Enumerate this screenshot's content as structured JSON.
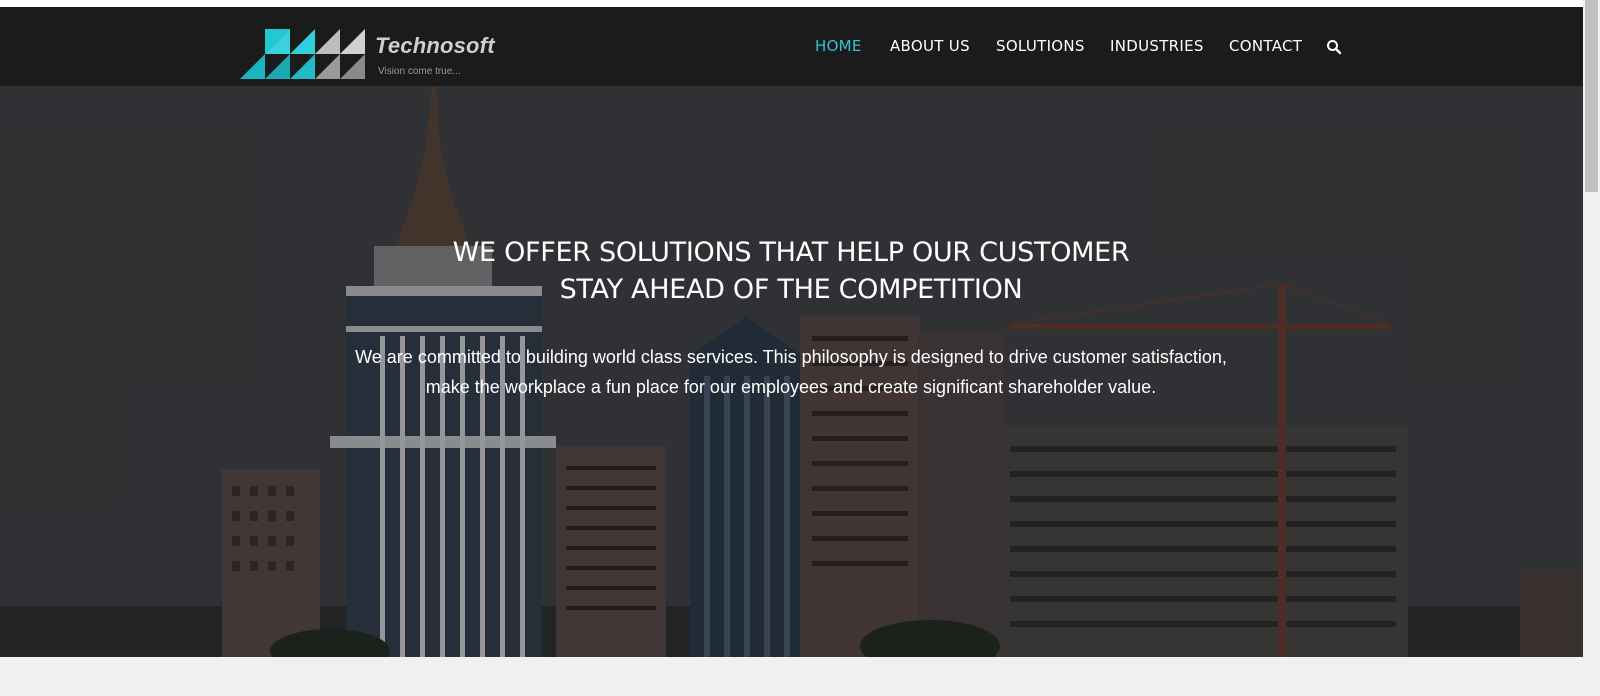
{
  "brand": {
    "name": "Technosoft",
    "tagline": "Vision come true..."
  },
  "nav": {
    "items": [
      {
        "label": "HOME",
        "active": true
      },
      {
        "label": "ABOUT US",
        "active": false
      },
      {
        "label": "SOLUTIONS",
        "active": false
      },
      {
        "label": "INDUSTRIES",
        "active": false
      },
      {
        "label": "CONTACT",
        "active": false
      }
    ],
    "search_icon": "search-icon"
  },
  "hero": {
    "title_line1": "WE OFFER SOLUTIONS THAT HELP OUR CUSTOMER",
    "title_line2": "STAY AHEAD OF THE COMPETITION",
    "text_line1": "We are committed to building world class services. This philosophy is designed to drive customer satisfaction,",
    "text_line2": "make the workplace a fun place for our employees and create significant shareholder value."
  },
  "colors": {
    "nav_bg": "#1b1b1b",
    "accent": "#2fc4cf",
    "page_bg": "#f0f0f0"
  }
}
